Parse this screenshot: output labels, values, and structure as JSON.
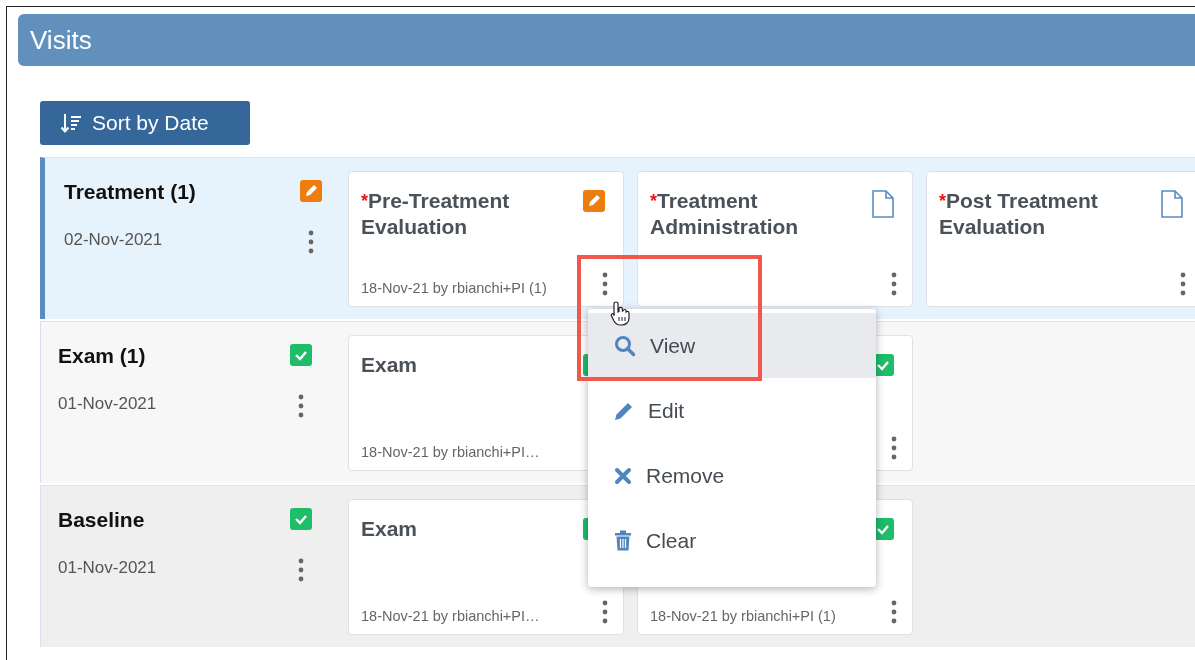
{
  "header": {
    "title": "Visits"
  },
  "sort_button": {
    "label": "Sort by Date"
  },
  "visits": [
    {
      "name": "Treatment (1)",
      "date": "02-Nov-2021",
      "status": {
        "kind": "edit"
      },
      "selected": true,
      "forms": [
        {
          "mark": "*",
          "title": "Pre-Treatment Evaluation",
          "status": {
            "kind": "edit"
          },
          "footer": "18-Nov-21 by rbianchi+PI (1)"
        },
        {
          "mark": "*",
          "title": "Treatment Administration",
          "status": {
            "kind": "document"
          }
        },
        {
          "mark": "*",
          "title": "Post Treatment Evaluation",
          "status": {
            "kind": "document"
          }
        }
      ]
    },
    {
      "name": "Exam (1)",
      "date": "01-Nov-2021",
      "status": {
        "kind": "done"
      },
      "selected": false,
      "forms": [
        {
          "title": "Exam",
          "status": {
            "kind": "done"
          },
          "footer": "18-Nov-21 by rbianchi+PI…"
        },
        {
          "status": {
            "kind": "done"
          }
        }
      ]
    },
    {
      "name": "Baseline",
      "date": "01-Nov-2021",
      "status": {
        "kind": "done"
      },
      "selected": false,
      "forms": [
        {
          "title": "Exam",
          "status": {
            "kind": "done"
          },
          "footer": "18-Nov-21 by rbianchi+PI…"
        },
        {
          "status": {
            "kind": "done"
          },
          "footer": "18-Nov-21 by rbianchi+PI (1)"
        }
      ]
    }
  ],
  "context_menu": {
    "items": [
      {
        "kind": "search",
        "label": "View",
        "selected": true
      },
      {
        "kind": "pencil",
        "label": "Edit",
        "selected": false
      },
      {
        "kind": "cross",
        "label": "Remove",
        "selected": false
      },
      {
        "kind": "trash",
        "label": "Clear",
        "selected": false
      }
    ]
  }
}
